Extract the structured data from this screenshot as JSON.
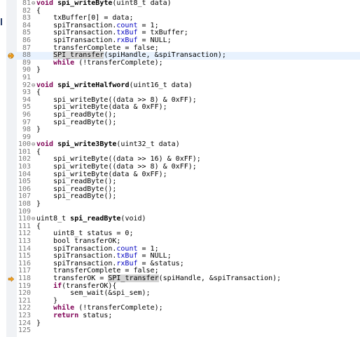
{
  "editor": {
    "lines": [
      {
        "n": "81",
        "fold": "⊖",
        "marker": "",
        "tokens": [
          {
            "t": "void ",
            "c": "kw"
          },
          {
            "t": "spi_writeByte",
            "c": "fn"
          },
          {
            "t": "(uint8_t data)"
          }
        ]
      },
      {
        "n": "82",
        "fold": "",
        "marker": "",
        "tokens": [
          {
            "t": "{"
          }
        ]
      },
      {
        "n": "83",
        "fold": "",
        "marker": "",
        "tokens": [
          {
            "t": "    txBuffer[0] = data;"
          }
        ]
      },
      {
        "n": "84",
        "fold": "",
        "marker": "",
        "tokens": [
          {
            "t": "    spiTransaction."
          },
          {
            "t": "count",
            "c": "field"
          },
          {
            "t": " = 1;"
          }
        ]
      },
      {
        "n": "85",
        "fold": "",
        "marker": "",
        "tokens": [
          {
            "t": "    spiTransaction."
          },
          {
            "t": "txBuf",
            "c": "field"
          },
          {
            "t": " = txBuffer;"
          }
        ]
      },
      {
        "n": "86",
        "fold": "",
        "marker": "",
        "tokens": [
          {
            "t": "    spiTransaction."
          },
          {
            "t": "rxBuf",
            "c": "field"
          },
          {
            "t": " = NULL;"
          }
        ]
      },
      {
        "n": "87",
        "fold": "",
        "marker": "",
        "tokens": [
          {
            "t": "    transferComplete = false;"
          }
        ]
      },
      {
        "n": "88",
        "fold": "",
        "marker": "both",
        "current": true,
        "tokens": [
          {
            "t": "    "
          },
          {
            "t": "SPI_transfer",
            "c": "callhl"
          },
          {
            "t": "(spiHandle, &spiTransaction);"
          }
        ]
      },
      {
        "n": "89",
        "fold": "",
        "marker": "",
        "tokens": [
          {
            "t": "    "
          },
          {
            "t": "while",
            "c": "kw"
          },
          {
            "t": " (!transferComplete);"
          }
        ]
      },
      {
        "n": "90",
        "fold": "",
        "marker": "",
        "tokens": [
          {
            "t": "}"
          }
        ]
      },
      {
        "n": "91",
        "fold": "",
        "marker": "",
        "tokens": []
      },
      {
        "n": "92",
        "fold": "⊖",
        "marker": "",
        "tokens": [
          {
            "t": "void ",
            "c": "kw"
          },
          {
            "t": "spi_writeHalfword",
            "c": "fn"
          },
          {
            "t": "(uint16_t data)"
          }
        ]
      },
      {
        "n": "93",
        "fold": "",
        "marker": "",
        "tokens": [
          {
            "t": "{"
          }
        ]
      },
      {
        "n": "94",
        "fold": "",
        "marker": "",
        "tokens": [
          {
            "t": "    spi_writeByte((data >> 8) & 0xFF);"
          }
        ]
      },
      {
        "n": "95",
        "fold": "",
        "marker": "",
        "tokens": [
          {
            "t": "    spi_writeByte(data & 0xFF);"
          }
        ]
      },
      {
        "n": "96",
        "fold": "",
        "marker": "",
        "tokens": [
          {
            "t": "    spi_readByte();"
          }
        ]
      },
      {
        "n": "97",
        "fold": "",
        "marker": "",
        "tokens": [
          {
            "t": "    spi_readByte();"
          }
        ]
      },
      {
        "n": "98",
        "fold": "",
        "marker": "",
        "tokens": [
          {
            "t": "}"
          }
        ]
      },
      {
        "n": "99",
        "fold": "",
        "marker": "",
        "tokens": []
      },
      {
        "n": "100",
        "fold": "⊖",
        "marker": "",
        "tokens": [
          {
            "t": "void ",
            "c": "kw"
          },
          {
            "t": "spi_write3Byte",
            "c": "fn"
          },
          {
            "t": "(uint32_t data)"
          }
        ]
      },
      {
        "n": "101",
        "fold": "",
        "marker": "",
        "tokens": [
          {
            "t": "{"
          }
        ]
      },
      {
        "n": "102",
        "fold": "",
        "marker": "",
        "tokens": [
          {
            "t": "    spi_writeByte((data >> 16) & 0xFF);"
          }
        ]
      },
      {
        "n": "103",
        "fold": "",
        "marker": "",
        "tokens": [
          {
            "t": "    spi_writeByte((data >> 8) & 0xFF);"
          }
        ]
      },
      {
        "n": "104",
        "fold": "",
        "marker": "",
        "tokens": [
          {
            "t": "    spi_writeByte(data & 0xFF);"
          }
        ]
      },
      {
        "n": "105",
        "fold": "",
        "marker": "",
        "tokens": [
          {
            "t": "    spi_readByte();"
          }
        ]
      },
      {
        "n": "106",
        "fold": "",
        "marker": "",
        "tokens": [
          {
            "t": "    spi_readByte();"
          }
        ]
      },
      {
        "n": "107",
        "fold": "",
        "marker": "",
        "tokens": [
          {
            "t": "    spi_readByte();"
          }
        ]
      },
      {
        "n": "108",
        "fold": "",
        "marker": "",
        "tokens": [
          {
            "t": "}"
          }
        ]
      },
      {
        "n": "109",
        "fold": "",
        "marker": "",
        "tokens": []
      },
      {
        "n": "110",
        "fold": "⊖",
        "marker": "",
        "tokens": [
          {
            "t": "uint8_t "
          },
          {
            "t": "spi_readByte",
            "c": "fn"
          },
          {
            "t": "(void)"
          }
        ]
      },
      {
        "n": "111",
        "fold": "",
        "marker": "",
        "tokens": [
          {
            "t": "{"
          }
        ]
      },
      {
        "n": "112",
        "fold": "",
        "marker": "",
        "tokens": [
          {
            "t": "    uint8_t status = 0;"
          }
        ]
      },
      {
        "n": "113",
        "fold": "",
        "marker": "",
        "tokens": [
          {
            "t": "    bool transferOK;"
          }
        ]
      },
      {
        "n": "114",
        "fold": "",
        "marker": "",
        "tokens": [
          {
            "t": "    spiTransaction."
          },
          {
            "t": "count",
            "c": "field"
          },
          {
            "t": " = 1;"
          }
        ]
      },
      {
        "n": "115",
        "fold": "",
        "marker": "",
        "tokens": [
          {
            "t": "    spiTransaction."
          },
          {
            "t": "txBuf",
            "c": "field"
          },
          {
            "t": " = NULL;"
          }
        ]
      },
      {
        "n": "116",
        "fold": "",
        "marker": "",
        "tokens": [
          {
            "t": "    spiTransaction."
          },
          {
            "t": "rxBuf",
            "c": "field"
          },
          {
            "t": " = &status;"
          }
        ]
      },
      {
        "n": "117",
        "fold": "",
        "marker": "",
        "tokens": [
          {
            "t": "    transferComplete = false;"
          }
        ]
      },
      {
        "n": "118",
        "fold": "",
        "marker": "bp",
        "tokens": [
          {
            "t": "    transferOK = "
          },
          {
            "t": "SPI_transfer",
            "c": "callhl"
          },
          {
            "t": "(spiHandle, &spiTransaction);"
          }
        ]
      },
      {
        "n": "119",
        "fold": "",
        "marker": "",
        "tokens": [
          {
            "t": "    "
          },
          {
            "t": "if",
            "c": "kw"
          },
          {
            "t": "(transferOK){"
          }
        ]
      },
      {
        "n": "120",
        "fold": "",
        "marker": "",
        "tokens": [
          {
            "t": "        sem_wait(&spi_sem);"
          }
        ]
      },
      {
        "n": "121",
        "fold": "",
        "marker": "",
        "tokens": [
          {
            "t": "    }"
          }
        ]
      },
      {
        "n": "122",
        "fold": "",
        "marker": "",
        "tokens": [
          {
            "t": "    "
          },
          {
            "t": "while",
            "c": "kw"
          },
          {
            "t": " (!transferComplete);"
          }
        ]
      },
      {
        "n": "123",
        "fold": "",
        "marker": "",
        "tokens": [
          {
            "t": "    "
          },
          {
            "t": "return",
            "c": "kw"
          },
          {
            "t": " status;"
          }
        ]
      },
      {
        "n": "124",
        "fold": "",
        "marker": "",
        "tokens": [
          {
            "t": "}"
          }
        ]
      },
      {
        "n": "125",
        "fold": "",
        "marker": "",
        "tokens": []
      }
    ]
  },
  "colors": {
    "keyword": "#7f0055",
    "field": "#0000c0",
    "current_line": "#e8f2fe",
    "gutter": "#f0f2f5",
    "breakpoint_arrow": "#f0a020"
  },
  "icons": {
    "breakpoint": "breakpoint-icon",
    "instruction_pointer": "instruction-pointer-icon",
    "fold": "collapse-icon"
  }
}
